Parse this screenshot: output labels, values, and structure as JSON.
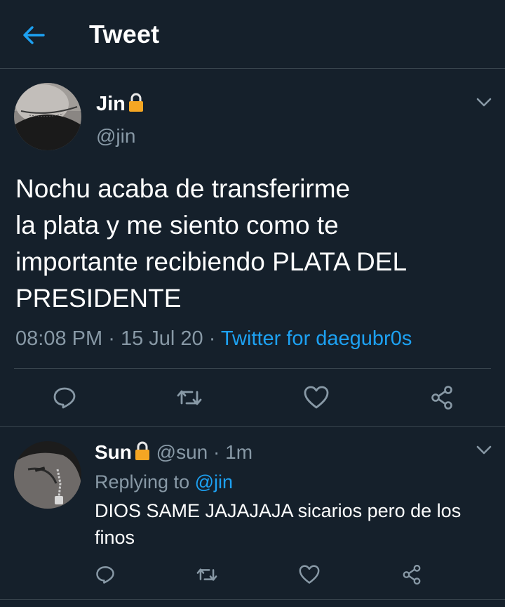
{
  "header": {
    "title": "Tweet"
  },
  "tweet": {
    "name": "Jin",
    "handle": "@jin",
    "text_lines": [
      "Nochu acaba de transferirme",
      "la plata y me siento como te",
      "importante recibiendo PLATA DEL",
      "PRESIDENTE"
    ],
    "time": "08:08 PM",
    "date": "15 Jul 20",
    "separator": "·",
    "source": "Twitter for daegubr0s"
  },
  "reply": {
    "name": "Sun",
    "handle": "@sun",
    "age": "1m",
    "separator": "·",
    "replying_label": "Replying to",
    "replying_handle": "@jin",
    "text": "DIOS SAME JAJAJAJA sicarios pero de los finos"
  },
  "icons": {
    "back": "arrow-left-icon",
    "lock": "lock-icon",
    "caret": "chevron-down-icon",
    "reply": "reply-icon",
    "retweet": "retweet-icon",
    "like": "heart-icon",
    "share": "share-icon"
  },
  "colors": {
    "background": "#15202b",
    "accent": "#1da1f2",
    "secondary_text": "#8899a6",
    "divider": "#38444d",
    "lock": "#f5a623"
  }
}
